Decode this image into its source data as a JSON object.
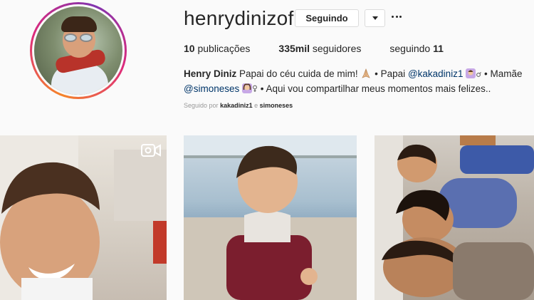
{
  "profile": {
    "username": "henrydinizof",
    "following_button": "Seguindo",
    "stats": {
      "posts_count": "10",
      "posts_label": "publicações",
      "followers_count": "335mil",
      "followers_label": "seguidores",
      "following_label": "seguindo",
      "following_count": "11"
    },
    "bio": {
      "name": "Henry Diniz",
      "text1": "Papai do céu cuida de mim!",
      "text2": "• Papai",
      "mention1": "@kakadiniz1",
      "text3": "• Mamãe",
      "mention2": "@simoneses",
      "text4": "• Aqui vou compartilhar meus momentos mais felizes.."
    },
    "followed_by": {
      "prefix": "Seguido por",
      "user1": "kakadiniz1",
      "conj": "e",
      "user2": "simoneses"
    }
  },
  "icons": {
    "dropdown": "chevron-down-icon",
    "more": "more-options-icon",
    "video": "video-camera-icon",
    "pray_emoji": "folded-hands-emoji",
    "man_emoji": "man-emoji",
    "woman_emoji": "woman-emoji"
  },
  "colors": {
    "mention": "#003569",
    "muted": "#999999",
    "border": "#dbdbdb",
    "ring_start": "#f58529",
    "ring_end": "#dd2a7b"
  }
}
